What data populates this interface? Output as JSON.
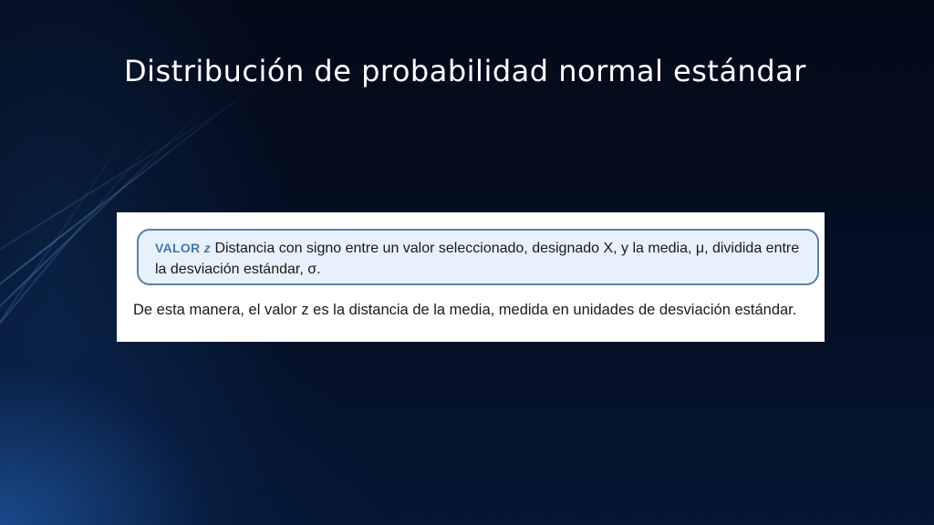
{
  "slide": {
    "title": "Distribución de probabilidad normal estándar"
  },
  "figure": {
    "definition": {
      "term": "VALOR",
      "term_variable": "z",
      "text": "Distancia con signo entre un valor seleccionado, designado X, y la media, μ, dividida entre la desviación estándar, σ."
    },
    "paragraph": "De esta manera, el valor z es la distancia de la media, medida en unidades de desviación estándar."
  },
  "colors": {
    "background": "#040d1e",
    "title_text": "#ffffff",
    "definition_border": "#5b7fa9",
    "definition_fill": "#e6f1fb",
    "term_color": "#4a76ad"
  }
}
